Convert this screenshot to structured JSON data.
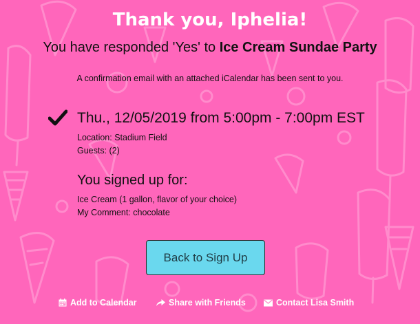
{
  "header": {
    "title": "Thank you, Iphelia!",
    "response_prefix": "You have responded 'Yes' to ",
    "event_name": "Ice Cream Sundae Party"
  },
  "confirmation_text": "A confirmation email with an attached iCalendar has been sent to you.",
  "event": {
    "datetime": "Thu., 12/05/2019 from 5:00pm - 7:00pm EST",
    "location": "Location: Stadium Field",
    "guests": "Guests: (2)"
  },
  "signup": {
    "heading": "You signed up for:",
    "item": "Ice Cream (1 gallon, flavor of your choice)",
    "comment": "My Comment: chocolate"
  },
  "back_button_label": "Back to Sign Up",
  "footer": {
    "add_to_calendar": "Add to Calendar",
    "share_with_friends": "Share with Friends",
    "contact": "Contact Lisa Smith"
  },
  "icons": {
    "confirmed": "checkmark-icon",
    "calendar": "calendar-icon",
    "share": "share-arrow-icon",
    "contact": "envelope-icon"
  },
  "colors": {
    "background": "#ff66bb",
    "button": "#6ad8ee",
    "title": "#ffffff"
  }
}
